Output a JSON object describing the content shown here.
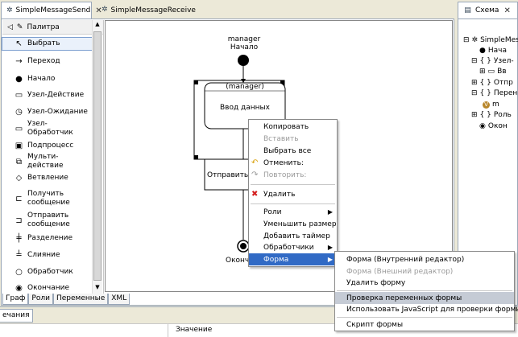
{
  "tabs": [
    {
      "label": "SimpleMessageSend",
      "active": true
    },
    {
      "label": "SimpleMessageReceive",
      "active": false
    }
  ],
  "outline_tab": {
    "label": "Схема"
  },
  "palette": {
    "title": "Палитра",
    "items": [
      {
        "label": "Выбрать",
        "icon": "cursor-icon"
      },
      {
        "label": "Переход",
        "icon": "arrow-icon"
      },
      {
        "label": "Начало",
        "icon": "filled-circle-icon"
      },
      {
        "label": "Узел-Действие",
        "icon": "rounded-rect-icon"
      },
      {
        "label": "Узел-Ожидание",
        "icon": "clock-icon"
      },
      {
        "label": "Узел-Обработчик",
        "icon": "handler-icon"
      },
      {
        "label": "Подпроцесс",
        "icon": "subprocess-icon"
      },
      {
        "label": "Мульти-действие",
        "icon": "multi-action-icon"
      },
      {
        "label": "Ветвление",
        "icon": "diamond-icon"
      },
      {
        "label": "Получить\nсообщение",
        "icon": "receive-icon"
      },
      {
        "label": "Отправить\nсообщение",
        "icon": "send-icon"
      },
      {
        "label": "Разделение",
        "icon": "fork-icon"
      },
      {
        "label": "Слияние",
        "icon": "join-icon"
      },
      {
        "label": "Обработчик",
        "icon": "small-circle-icon"
      },
      {
        "label": "Окончание",
        "icon": "end-circle-icon"
      }
    ]
  },
  "bottom_tabs": [
    "Граф",
    "Роли",
    "Переменные",
    "XML"
  ],
  "diagram": {
    "start_role": "manager",
    "start_label": "Начало",
    "task1_role": "(manager)",
    "task1_name": "Ввод данных",
    "task2_name": "Отправить д",
    "end_label": "Оконч"
  },
  "context_menu": [
    {
      "label": "Копировать",
      "enabled": true
    },
    {
      "label": "Вставить",
      "enabled": false
    },
    {
      "label": "Выбрать все",
      "enabled": true
    },
    {
      "label": "Отменить:",
      "enabled": true,
      "icon": "undo-icon"
    },
    {
      "label": "Повторить:",
      "enabled": false,
      "icon": "redo-icon"
    },
    {
      "label": "Удалить",
      "enabled": true,
      "icon": "delete-icon"
    },
    {
      "label": "Роли",
      "enabled": true,
      "submenu": true
    },
    {
      "label": "Уменьшить размер",
      "enabled": true
    },
    {
      "label": "Добавить таймер",
      "enabled": true
    },
    {
      "label": "Обработчики",
      "enabled": true,
      "submenu": true
    },
    {
      "label": "Форма",
      "enabled": true,
      "submenu": true,
      "highlighted": true
    }
  ],
  "form_submenu": [
    {
      "label": "Форма (Внутренний редактор)",
      "enabled": true
    },
    {
      "label": "Форма (Внешний редактор)",
      "enabled": false
    },
    {
      "label": "Удалить форму",
      "enabled": true
    },
    {
      "label": "Проверка переменных формы",
      "enabled": true,
      "highlighted": true
    },
    {
      "label": "Использовать JavaScript для проверки формы",
      "enabled": true
    },
    {
      "label": "Скрипт формы",
      "enabled": true
    }
  ],
  "outline": {
    "root": "SimpleMes",
    "rows": [
      {
        "label": "Нача",
        "icon": "filled-circle-icon"
      },
      {
        "label": "Узел-",
        "icon": "brace-icon"
      },
      {
        "label": "Вв",
        "icon": "rounded-rect-icon"
      },
      {
        "label": "Отпр",
        "icon": "brace-icon"
      },
      {
        "label": "Перен",
        "icon": "brace-icon"
      },
      {
        "label": "m",
        "icon": "variable-icon"
      },
      {
        "label": "Роль",
        "icon": "brace-icon"
      },
      {
        "label": "Окон",
        "icon": "end-circle-icon"
      }
    ]
  },
  "status_bar": {
    "left": "ечания",
    "column": "Значение"
  },
  "colors": {
    "menu_highlight": "#316ac5",
    "submenu_highlight": "#c5cbd5"
  }
}
